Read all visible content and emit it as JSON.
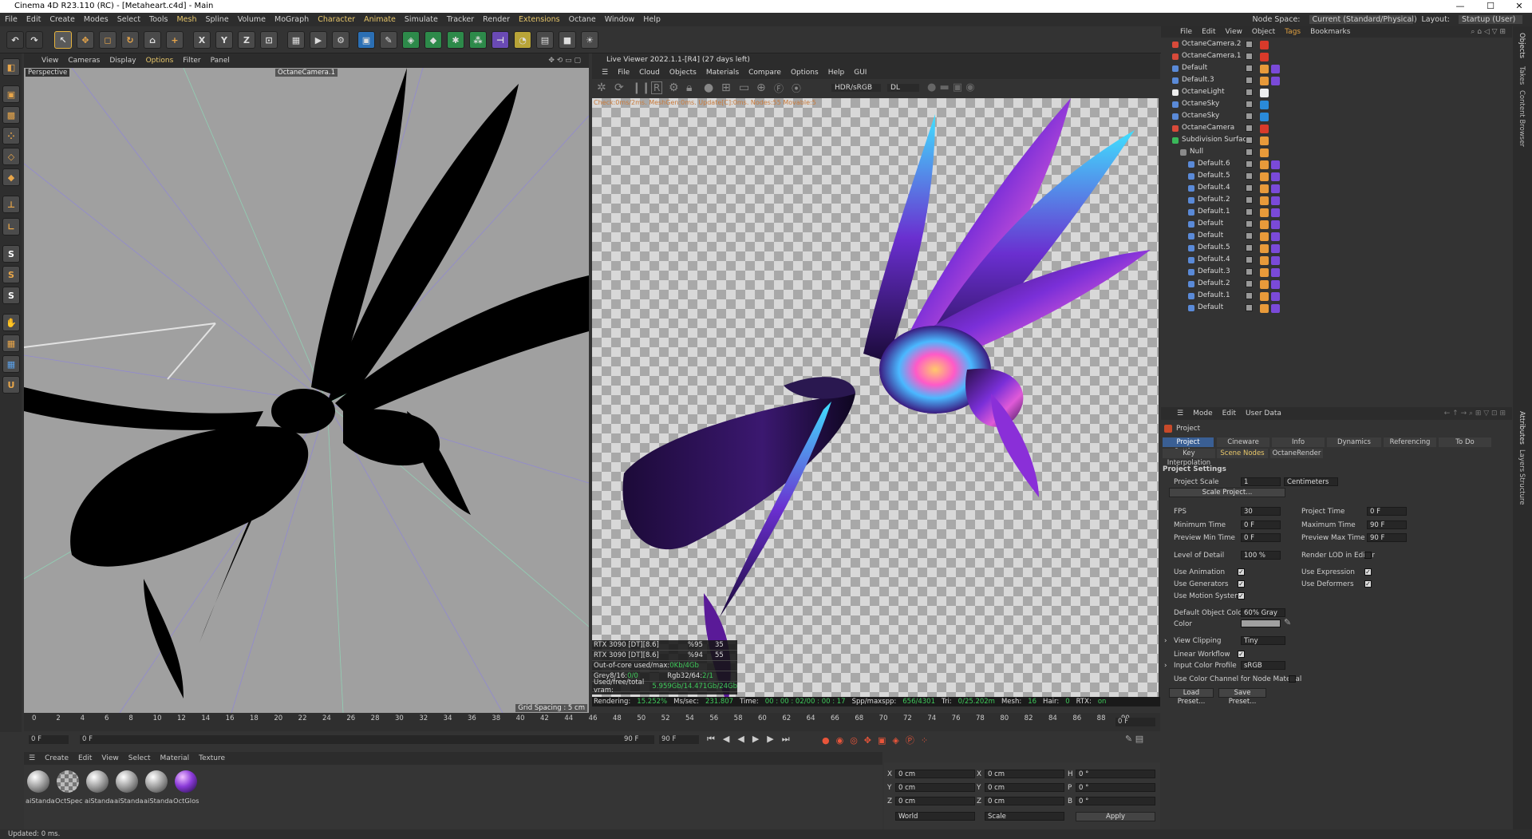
{
  "window": {
    "title": "Cinema 4D R23.110 (RC) - [Metaheart.c4d] - Main",
    "min": "—",
    "max": "☐",
    "close": "✕"
  },
  "menubar": {
    "items": [
      "File",
      "Edit",
      "Create",
      "Modes",
      "Select",
      "Tools",
      "Mesh",
      "Spline",
      "Volume",
      "MoGraph",
      "Character",
      "Animate",
      "Simulate",
      "Tracker",
      "Render",
      "Extensions",
      "Octane",
      "Window",
      "Help"
    ],
    "node_space_label": "Node Space:",
    "node_space_value": "Current (Standard/Physical)",
    "layout_label": "Layout:",
    "layout_value": "Startup (User)"
  },
  "toolbar": {
    "x": "X",
    "y": "Y",
    "z": "Z"
  },
  "viewport": {
    "menu": [
      "View",
      "Cameras",
      "Display",
      "Options",
      "Filter",
      "Panel"
    ],
    "label": "Perspective",
    "camera": "OctaneCamera.1",
    "grid": "Grid Spacing : 5 cm"
  },
  "liveviewer": {
    "title": "Live Viewer 2022.1.1-[R4] (27 days left)",
    "menu": [
      "File",
      "Cloud",
      "Objects",
      "Materials",
      "Compare",
      "Options",
      "Help",
      "GUI"
    ],
    "colorspace": "HDR/sRGB",
    "kernel": "DL",
    "status_line": "Check:0ms/2ms. MeshGen:0ms. Update[C]:0ms. Nodes:55 Movable:5",
    "gpu": [
      {
        "name": "RTX 3090 [DT][8.6]",
        "pct": "%95",
        "val": "35"
      },
      {
        "name": "RTX 3090 [DT][8.6]",
        "pct": "%94",
        "val": "55"
      }
    ],
    "ooc_label": "Out-of-core used/max:",
    "ooc_value": "0Kb/4Gb",
    "grey_label": "Grey8/16:",
    "grey_value": "0/0",
    "rgb_label": "Rgb32/64:",
    "rgb_value": "2/1",
    "vram_label": "Used/free/total vram:",
    "vram_value": "5.959Gb/14.471Gb/24Gb",
    "rendering_label": "Rendering:",
    "rendering_value": "15.252%",
    "ms_label": "Ms/sec:",
    "ms_value": "231.807",
    "time_label": "Time:",
    "time_value": "00 : 00 : 02/00 : 00 : 17",
    "spp_label": "Spp/maxspp:",
    "spp_value": "656/4301",
    "tri_label": "Tri:",
    "tri_value": "0/25.202m",
    "mesh_label": "Mesh:",
    "mesh_value": "16",
    "hair_label": "Hair:",
    "hair_value": "0",
    "rtx_label": "RTX:",
    "rtx_value": "on"
  },
  "timeline": {
    "ticks": [
      "0",
      "2",
      "4",
      "6",
      "8",
      "10",
      "12",
      "14",
      "16",
      "18",
      "20",
      "22",
      "24",
      "26",
      "28",
      "30",
      "32",
      "34",
      "36",
      "38",
      "40",
      "42",
      "44",
      "46",
      "48",
      "50",
      "52",
      "54",
      "56",
      "58",
      "60",
      "62",
      "64",
      "66",
      "68",
      "70",
      "72",
      "74",
      "76",
      "78",
      "80",
      "82",
      "84",
      "86",
      "88",
      "90"
    ],
    "current": "0 F",
    "start": "0 F",
    "start2": "0 F",
    "end": "90 F",
    "end2": "90 F"
  },
  "materials": {
    "menu": [
      "Create",
      "Edit",
      "View",
      "Select",
      "Material",
      "Texture"
    ],
    "items": [
      "aiStanda",
      "OctSpec",
      "aiStanda",
      "aiStanda",
      "aiStanda",
      "OctGlos"
    ]
  },
  "coords": {
    "x1": "0 cm",
    "y1": "0 cm",
    "z1": "0 cm",
    "x2": "0 cm",
    "y2": "0 cm",
    "z2": "0 cm",
    "h": "0 °",
    "p": "0 °",
    "b": "0 °",
    "space": "World",
    "mode": "Scale",
    "apply": "Apply"
  },
  "objects": {
    "menu": [
      "File",
      "Edit",
      "View",
      "Object",
      "Tags",
      "Bookmarks"
    ],
    "rows": [
      {
        "name": "OctaneCamera.2",
        "indent": 0
      },
      {
        "name": "OctaneCamera.1",
        "indent": 0
      },
      {
        "name": "Default",
        "indent": 0
      },
      {
        "name": "Default.3",
        "indent": 0
      },
      {
        "name": "OctaneLight",
        "indent": 0
      },
      {
        "name": "OctaneSky",
        "indent": 0
      },
      {
        "name": "OctaneSky",
        "indent": 0
      },
      {
        "name": "OctaneCamera",
        "indent": 0
      },
      {
        "name": "Subdivision Surface",
        "indent": 0
      },
      {
        "name": "Null",
        "indent": 1
      },
      {
        "name": "Default.6",
        "indent": 2
      },
      {
        "name": "Default.5",
        "indent": 2
      },
      {
        "name": "Default.4",
        "indent": 2
      },
      {
        "name": "Default.2",
        "indent": 2
      },
      {
        "name": "Default.1",
        "indent": 2
      },
      {
        "name": "Default",
        "indent": 2
      },
      {
        "name": "Default",
        "indent": 2
      },
      {
        "name": "Default.5",
        "indent": 2
      },
      {
        "name": "Default.4",
        "indent": 2
      },
      {
        "name": "Default.3",
        "indent": 2
      },
      {
        "name": "Default.2",
        "indent": 2
      },
      {
        "name": "Default.1",
        "indent": 2
      },
      {
        "name": "Default",
        "indent": 2
      }
    ]
  },
  "attributes": {
    "menu": [
      "Mode",
      "Edit",
      "User Data"
    ],
    "object": "Project",
    "tabs1": [
      "Project Settings",
      "Cineware",
      "Info",
      "Dynamics",
      "Referencing",
      "To Do"
    ],
    "tabs2": [
      "Key Interpolation",
      "Scene Nodes",
      "OctaneRender"
    ],
    "section": "Project Settings",
    "scale_label": "Project Scale",
    "scale_value": "1",
    "scale_unit": "Centimeters",
    "scale_btn": "Scale Project...",
    "fps_label": "FPS",
    "fps": "30",
    "ptime_label": "Project Time",
    "ptime": "0 F",
    "mintime_label": "Minimum Time",
    "mintime": "0 F",
    "maxtime_label": "Maximum Time",
    "maxtime": "90 F",
    "pmin_label": "Preview Min Time",
    "pmin": "0 F",
    "pmax_label": "Preview Max Time",
    "pmax": "90 F",
    "lod_label": "Level of Detail",
    "lod": "100 %",
    "rlod_label": "Render LOD in Editor",
    "anim_label": "Use Animation",
    "expr_label": "Use Expression",
    "gen_label": "Use Generators",
    "def_label": "Use Deformers",
    "motion_label": "Use Motion System",
    "doc_label": "Default Object Color",
    "doc_value": "60% Gray",
    "color_label": "Color",
    "clip_label": "View Clipping",
    "clip_value": "Tiny",
    "linear_label": "Linear Workflow",
    "icp_label": "Input Color Profile",
    "icp_value": "sRGB",
    "ucc_label": "Use Color Channel for Node Material",
    "load": "Load Preset...",
    "save": "Save Preset..."
  },
  "side": {
    "tabs": [
      "Objects",
      "Takes",
      "Content Browser"
    ],
    "tabs2": [
      "Attributes",
      "Layers",
      "Structure"
    ]
  },
  "status": "Updated: 0 ms."
}
